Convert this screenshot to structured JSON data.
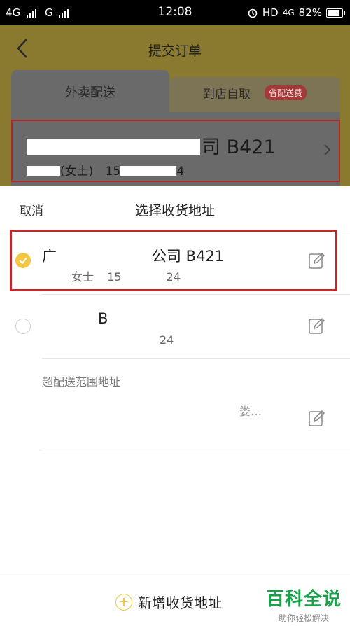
{
  "status_bar": {
    "network1": "4G",
    "network2": "G",
    "time": "12:08",
    "hd": "HD",
    "net_right": "4G",
    "battery": "82%"
  },
  "header": {
    "title": "提交订单",
    "tab_delivery": "外卖配送",
    "tab_pickup": "到店自取",
    "pickup_badge": "省配送费"
  },
  "current_address": {
    "line1": "司 B421",
    "name": "(女士)",
    "phone": "15",
    "phone_tail": "4"
  },
  "sheet": {
    "cancel": "取消",
    "title": "选择收货地址",
    "addresses": [
      {
        "line1_prefix": "广",
        "line1": "公司 B421",
        "name": "女士",
        "phone": "15",
        "phone_tail": "24",
        "selected": true
      },
      {
        "line1": "B",
        "phone_tail": "24",
        "selected": false
      }
    ],
    "out_of_range_label": "超配送范围地址",
    "out_of_range": [
      {
        "text": "娄…"
      }
    ],
    "add_button": "新增收货地址"
  },
  "watermark": {
    "title": "百科全说",
    "subtitle": "助你轻松解决"
  },
  "colors": {
    "accent": "#f3c540",
    "highlight": "#c02a2a",
    "watermark": "#1aa04a"
  }
}
